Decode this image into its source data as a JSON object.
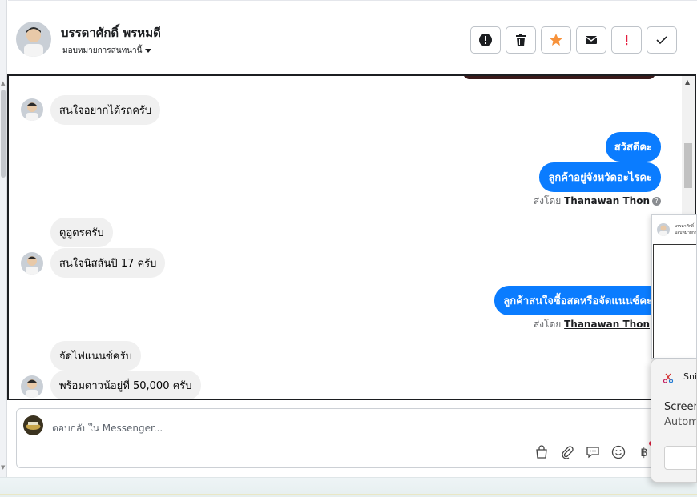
{
  "header": {
    "contact_name": "บรรดาศักดิ์ พรหมดี",
    "assign_label": "มอบหมายการสนทนานี้",
    "actions": [
      {
        "name": "report-spam",
        "icon": "alert-circle-icon"
      },
      {
        "name": "delete",
        "icon": "trash-icon"
      },
      {
        "name": "star",
        "icon": "star-icon",
        "color": "#f7923b"
      },
      {
        "name": "mark-unread",
        "icon": "envelope-icon"
      },
      {
        "name": "follow-up",
        "icon": "exclamation-icon",
        "color": "#e41e3f"
      },
      {
        "name": "mark-done",
        "icon": "check-icon"
      }
    ]
  },
  "messages": {
    "m1": "สนใจอยากได้รถครับ",
    "m2": "สวัสดีคะ",
    "m3": "ลูกค้าอยู่จังหวัดอะไรคะ",
    "m4": "ดูอูดรครับ",
    "m5": "สนใจนิสสันปี 17 ครับ",
    "m6": "ลูกค้าสนใจซื้อสดหรือจัดแนนซ์คะ",
    "m7": "จัดไฟแนนซ์ครับ",
    "m8": "พร้อมดาวน้อยู่ที่ 50,000 ครับ"
  },
  "sent_by": {
    "prefix": "ส่งโดย",
    "agent": "Thanawan Thon"
  },
  "composer": {
    "placeholder": "ตอบกลับใน Messenger...",
    "tools": [
      "shopping-bag-icon",
      "paperclip-icon",
      "saved-reply-icon",
      "emoji-icon",
      "baht-icon"
    ],
    "baht_symbol": "฿"
  },
  "mini_panel": {
    "name_snippet": "บรรดาศักดิ์",
    "sub_snippet": "มอบหมายการ"
  },
  "snip_toast": {
    "title": "Snip",
    "line1": "Screen",
    "line2": "Autom"
  },
  "colors": {
    "outgoing_bubble": "#0a7cff",
    "incoming_bubble": "#f0f0f0"
  }
}
